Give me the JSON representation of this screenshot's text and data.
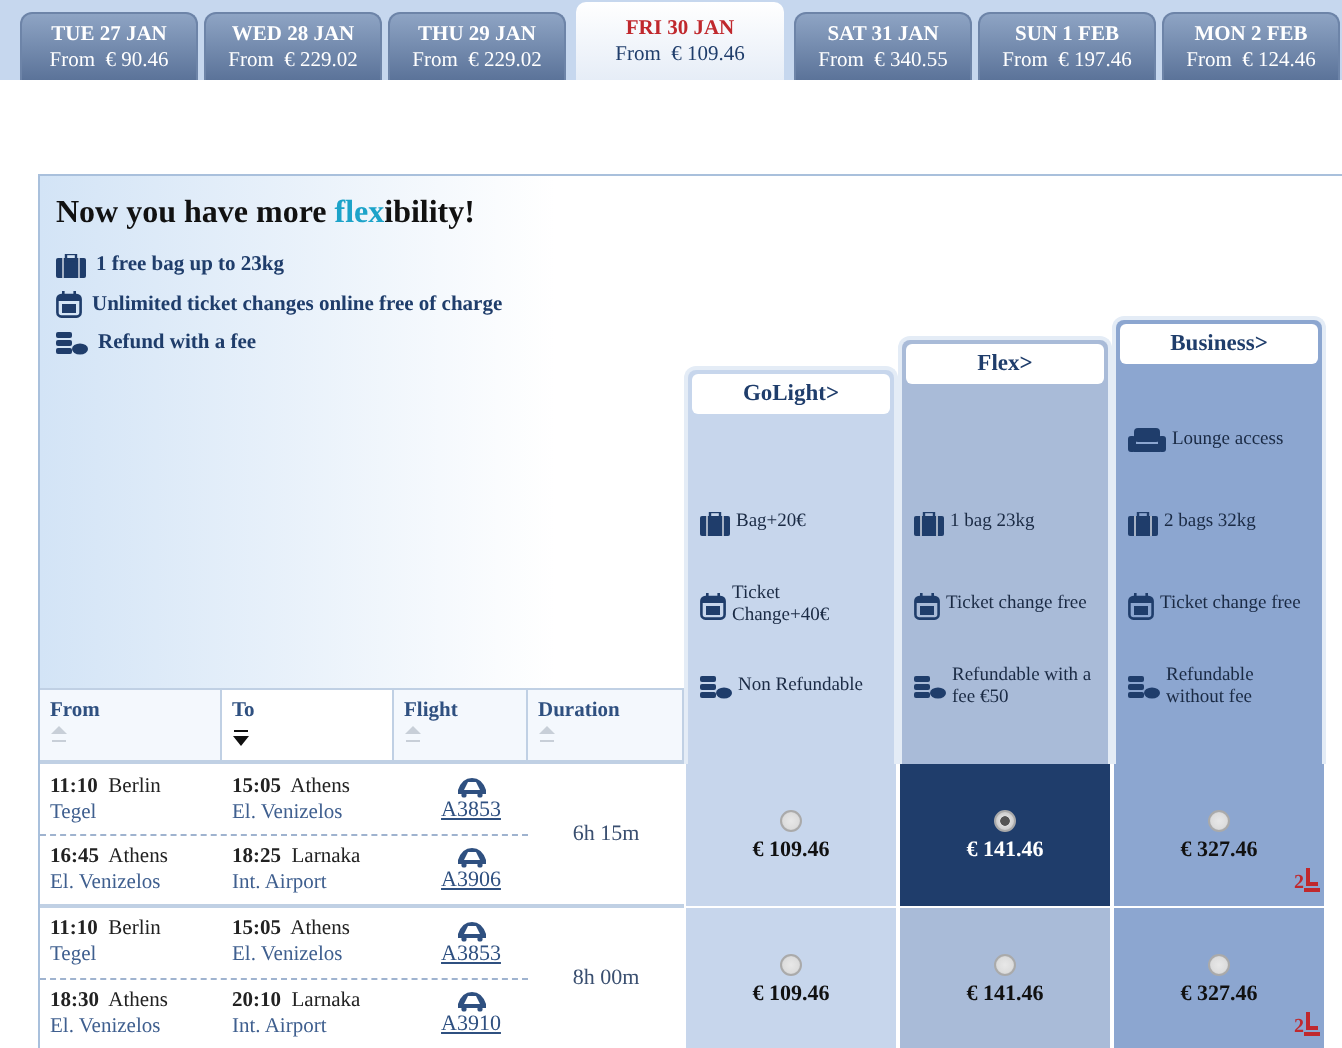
{
  "date_tabs": [
    {
      "day": "TUE 27 JAN",
      "price": "From  € 90.46",
      "selected": false
    },
    {
      "day": "WED 28 JAN",
      "price": "From  € 229.02",
      "selected": false
    },
    {
      "day": "THU 29 JAN",
      "price": "From  € 229.02",
      "selected": false
    },
    {
      "day": "FRI 30 JAN",
      "price": "From  € 109.46",
      "selected": true
    },
    {
      "day": "SAT 31 JAN",
      "price": "From  € 340.55",
      "selected": false
    },
    {
      "day": "SUN 1 FEB",
      "price": "From  € 197.46",
      "selected": false
    },
    {
      "day": "MON 2 FEB",
      "price": "From  € 124.46",
      "selected": false
    }
  ],
  "promo": {
    "title": "Now you have more **flex**ibility!",
    "benefits": [
      {
        "kind": "bag",
        "text": "1 free bag up to 23kg"
      },
      {
        "kind": "calendar",
        "text": "Unlimited ticket changes online free of charge"
      },
      {
        "kind": "coins",
        "text": "Refund with a fee"
      }
    ]
  },
  "fares": [
    {
      "name": "GoLight",
      "arrow": ">",
      "features": [
        {
          "kind": "bag",
          "text": "Bag+20€"
        },
        {
          "kind": "calendar",
          "text": "Ticket Change+40€"
        },
        {
          "kind": "coins",
          "text": "Non Refundable"
        }
      ]
    },
    {
      "name": "Flex",
      "arrow": ">",
      "features": [
        {
          "kind": "bag",
          "text": "1 bag 23kg"
        },
        {
          "kind": "calendar",
          "text": "Ticket change free"
        },
        {
          "kind": "coins",
          "text": "Refundable with a fee €50"
        }
      ]
    },
    {
      "name": "Business",
      "arrow": ">",
      "features": [
        {
          "kind": "sofa",
          "text": "Lounge access"
        },
        {
          "kind": "bag",
          "text": "2 bags 32kg"
        },
        {
          "kind": "calendar",
          "text": "Ticket change free"
        },
        {
          "kind": "coins",
          "text": "Refundable without fee"
        }
      ]
    }
  ],
  "columns": [
    {
      "label": "From",
      "sorted": false
    },
    {
      "label": "To",
      "sorted": true
    },
    {
      "label": "Flight",
      "sorted": false
    },
    {
      "label": "Duration",
      "sorted": false
    }
  ],
  "journeys": [
    {
      "legs": [
        {
          "dep_time": "11:10",
          "dep_city": "Berlin",
          "dep_airport": "Tegel",
          "arr_time": "15:05",
          "arr_city": "Athens",
          "arr_airport": "El. Venizelos",
          "flight": "A3853"
        },
        {
          "dep_time": "16:45",
          "dep_city": "Athens",
          "dep_airport": "El. Venizelos",
          "arr_time": "18:25",
          "arr_city": "Larnaka",
          "arr_airport": "Int. Airport",
          "flight": "A3906"
        }
      ],
      "duration": "6h 15m",
      "prices": [
        {
          "amount": "€ 109.46",
          "selected": false
        },
        {
          "amount": "€ 141.46",
          "selected": true
        },
        {
          "amount": "€ 327.46",
          "selected": false,
          "seats_left": "2"
        }
      ]
    },
    {
      "legs": [
        {
          "dep_time": "11:10",
          "dep_city": "Berlin",
          "dep_airport": "Tegel",
          "arr_time": "15:05",
          "arr_city": "Athens",
          "arr_airport": "El. Venizelos",
          "flight": "A3853"
        },
        {
          "dep_time": "18:30",
          "dep_city": "Athens",
          "dep_airport": "El. Venizelos",
          "arr_time": "20:10",
          "arr_city": "Larnaka",
          "arr_airport": "Int. Airport",
          "flight": "A3910"
        }
      ],
      "duration": "8h 00m",
      "prices": [
        {
          "amount": "€ 109.46",
          "selected": false
        },
        {
          "amount": "€ 141.46",
          "selected": false
        },
        {
          "amount": "€ 327.46",
          "selected": false,
          "seats_left": "2"
        }
      ]
    }
  ]
}
